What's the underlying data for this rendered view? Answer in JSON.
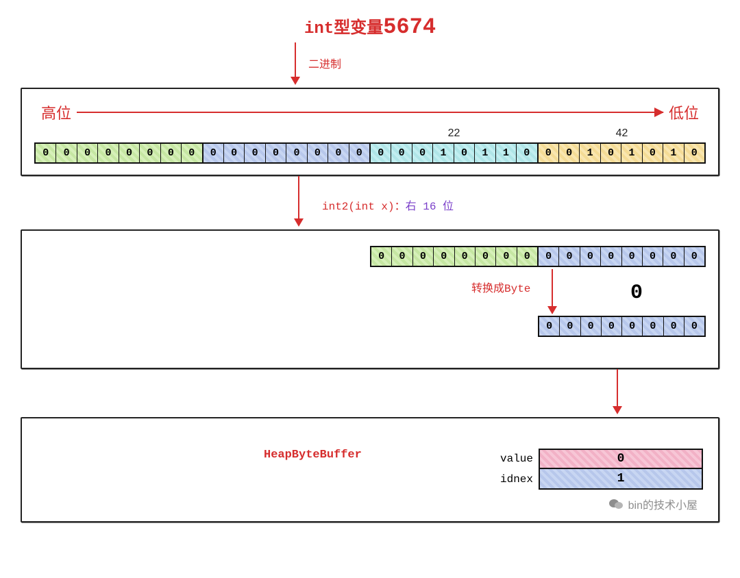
{
  "title_prefix": "int型变量",
  "title_number": "5674",
  "arrow1_label": "二进制",
  "high_label": "高位",
  "low_label": "低位",
  "byte_values": [
    "",
    "",
    "22",
    "42"
  ],
  "bytes_top": {
    "b0": [
      "0",
      "0",
      "0",
      "0",
      "0",
      "0",
      "0",
      "0"
    ],
    "b1": [
      "0",
      "0",
      "0",
      "0",
      "0",
      "0",
      "0",
      "0"
    ],
    "b2": [
      "0",
      "0",
      "0",
      "1",
      "0",
      "1",
      "1",
      "0"
    ],
    "b3": [
      "0",
      "0",
      "1",
      "0",
      "1",
      "0",
      "1",
      "0"
    ]
  },
  "mid_label_fn": "int2(int x)：",
  "mid_label_action": "右 16 位",
  "shifted": {
    "high": [
      "0",
      "0",
      "0",
      "0",
      "0",
      "0",
      "0",
      "0"
    ],
    "low": [
      "0",
      "0",
      "0",
      "0",
      "0",
      "0",
      "0",
      "0"
    ]
  },
  "conv_label": "转换成Byte",
  "result_big": "0",
  "result_bits": [
    "0",
    "0",
    "0",
    "0",
    "0",
    "0",
    "0",
    "0"
  ],
  "heap_label": "HeapByteBuffer",
  "kv": {
    "value_label": "value",
    "value": "0",
    "index_label": "idnex",
    "index": "1"
  },
  "watermark": "bin的技术小屋"
}
